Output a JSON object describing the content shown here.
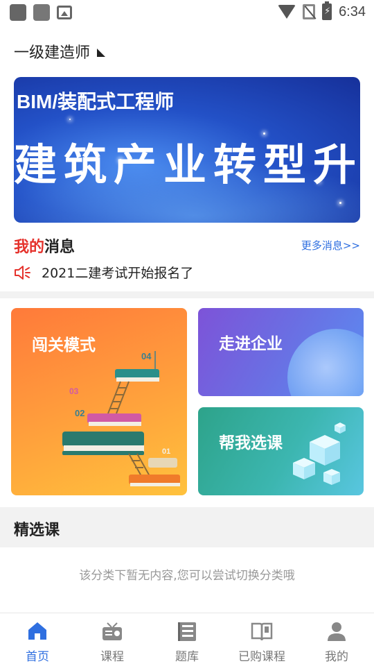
{
  "status_bar": {
    "time": "6:34"
  },
  "city": {
    "label": "一级建造师"
  },
  "banner": {
    "title": "BIM/装配式工程师",
    "headline": "建筑产业转型升级"
  },
  "messages": {
    "title_red": "我的",
    "title_rest": "消息",
    "more": "更多消息>>",
    "item": "2021二建考试开始报名了"
  },
  "cards": {
    "challenge": "闯关模式",
    "enterprise": "走进企业",
    "course": "帮我选课"
  },
  "section": {
    "title": "精选课"
  },
  "empty": {
    "text": "该分类下暂无内容,您可以尝试切换分类哦"
  },
  "bottom_nav": [
    {
      "label": "首页",
      "icon": "home-icon",
      "active": true
    },
    {
      "label": "课程",
      "icon": "radio-icon",
      "active": false
    },
    {
      "label": "题库",
      "icon": "question-bank-icon",
      "active": false
    },
    {
      "label": "已购课程",
      "icon": "book-icon",
      "active": false
    },
    {
      "label": "我的",
      "icon": "person-icon",
      "active": false
    }
  ],
  "colors": {
    "accent": "#2f6fe0",
    "highlight": "#e5322c"
  }
}
